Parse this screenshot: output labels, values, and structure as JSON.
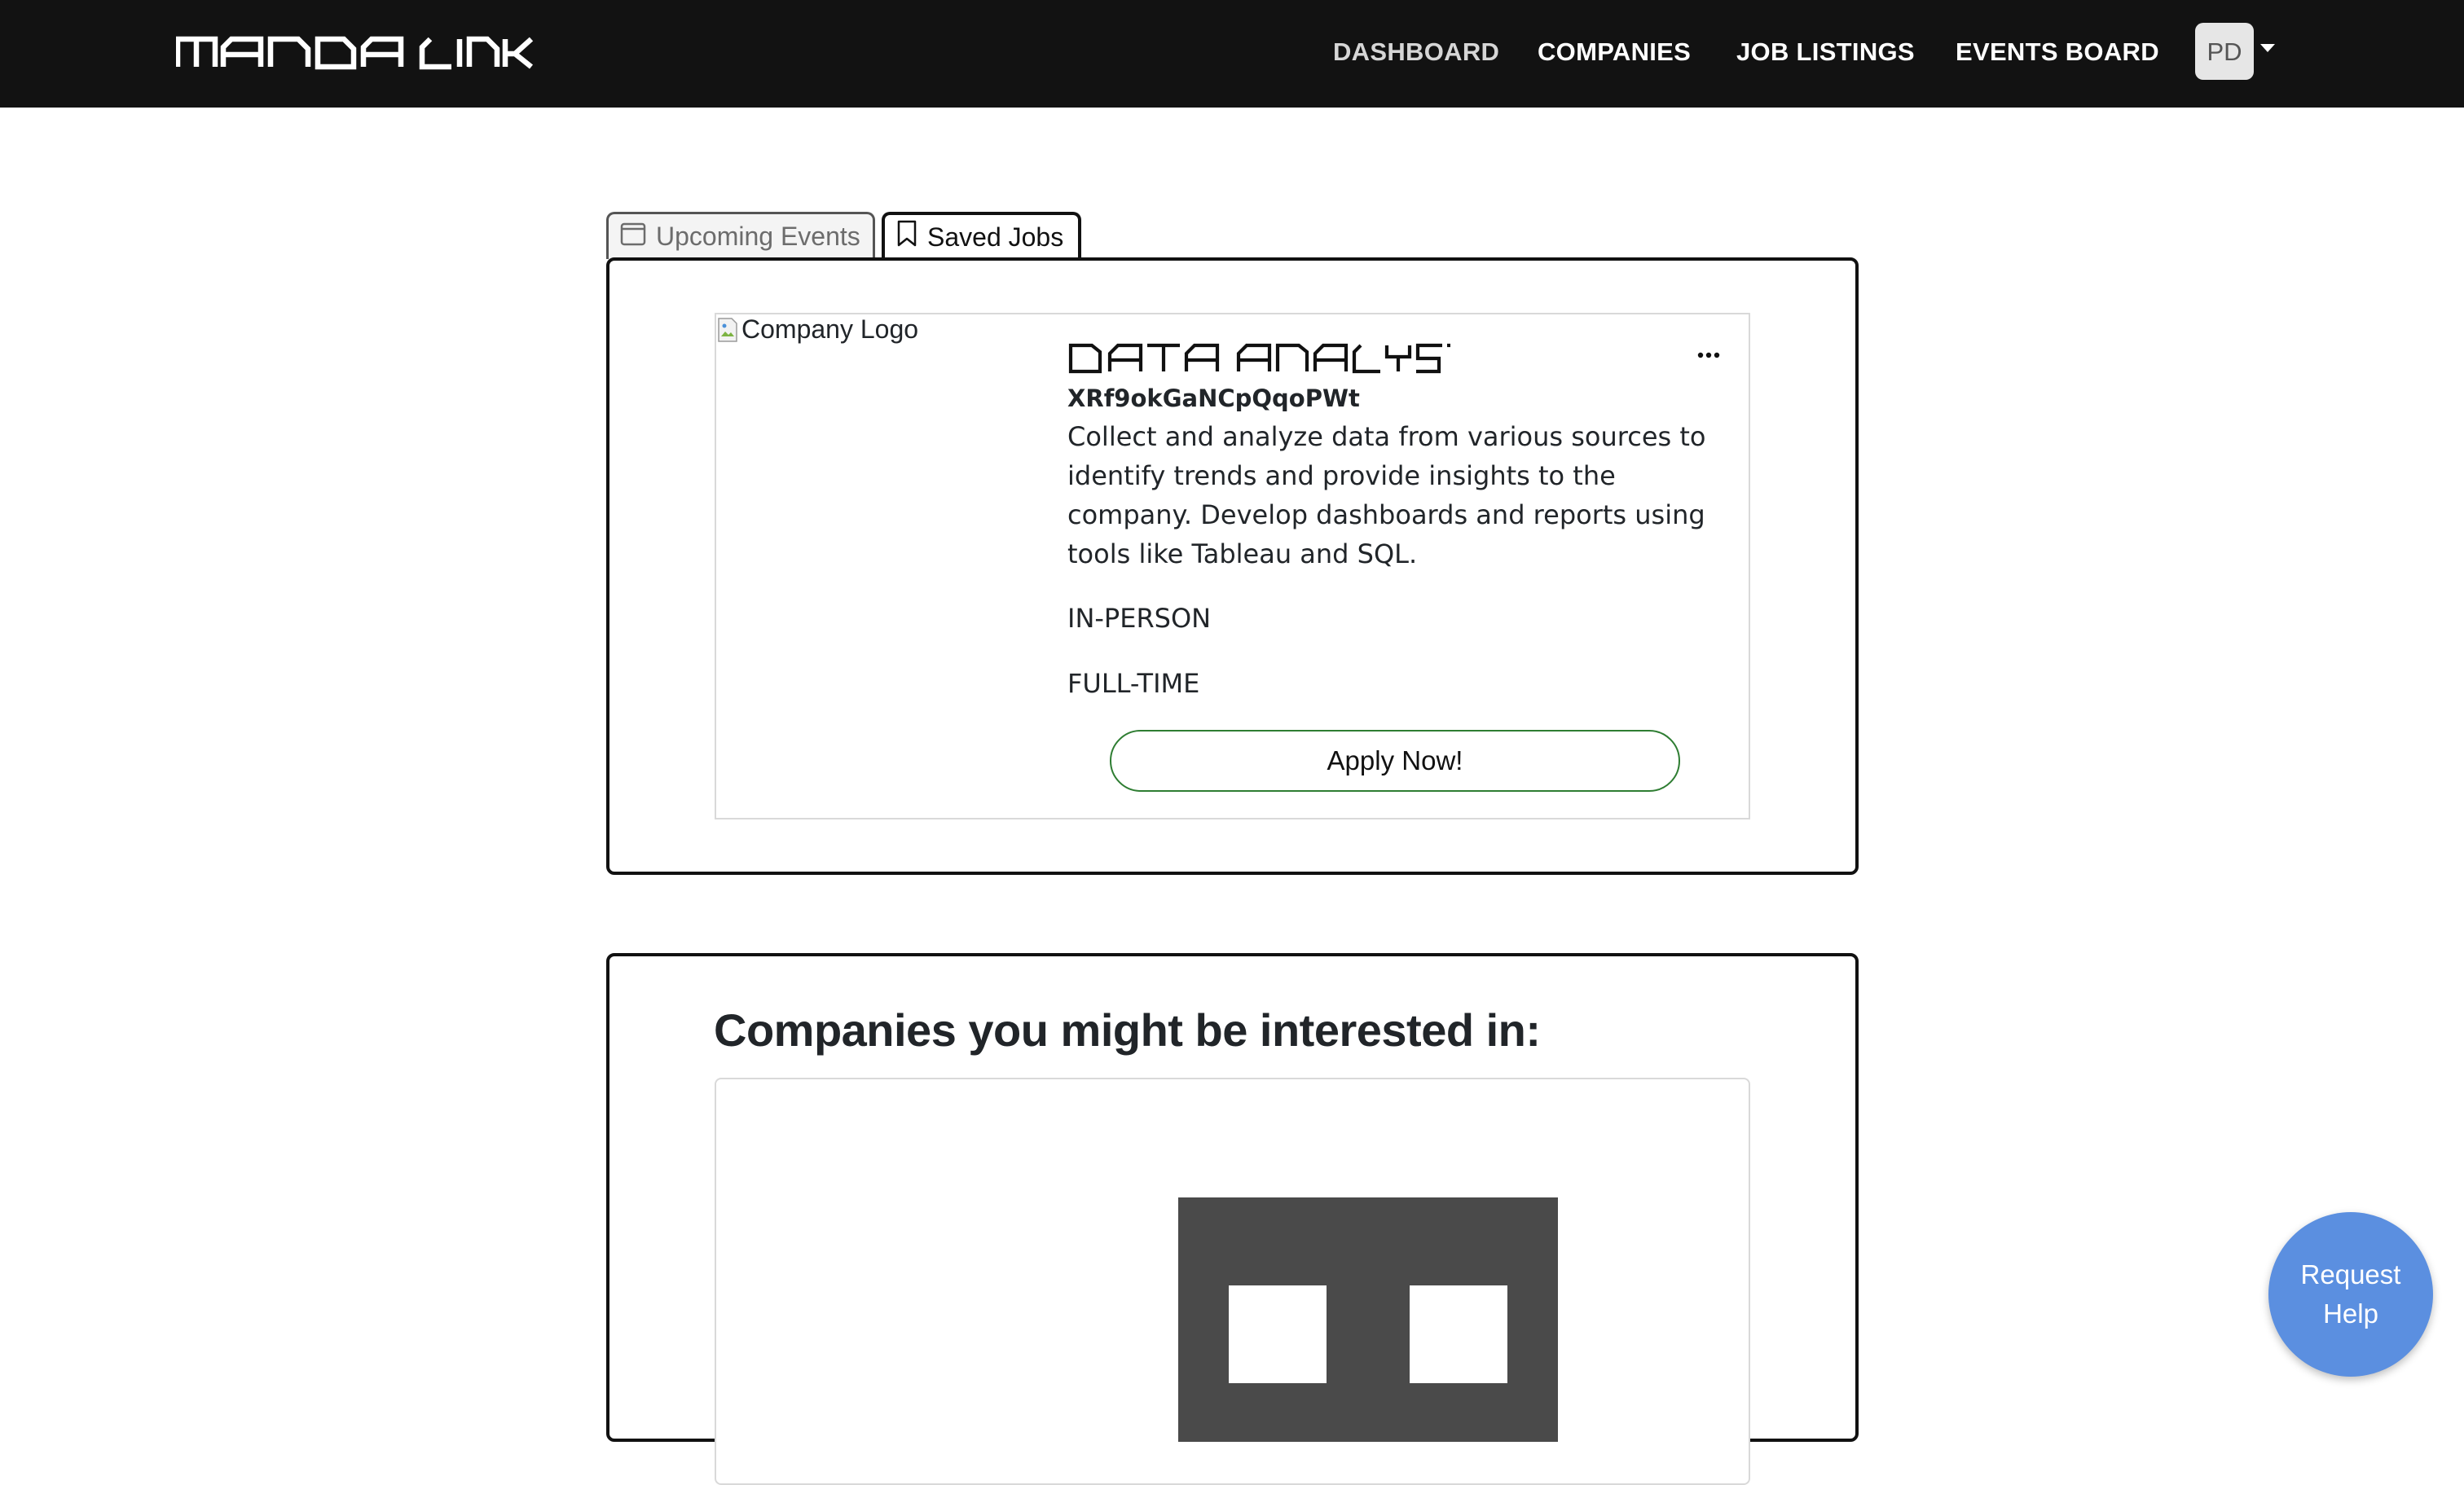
{
  "navbar": {
    "brand": "MANOA LINK",
    "links": {
      "dashboard": "DASHBOARD",
      "companies": "COMPANIES",
      "job_listings": "JOB LISTINGS",
      "events_board": "EVENTS BOARD"
    },
    "avatar_initials": "PD",
    "active_link_color": "#d6d6d6",
    "background": "#121212"
  },
  "tabs": {
    "upcoming_events": {
      "label": "Upcoming Events",
      "icon": "calendar-icon"
    },
    "saved_jobs": {
      "label": "Saved Jobs",
      "icon": "bookmark-icon",
      "selected": true
    }
  },
  "saved_job": {
    "logo_alt": "Company Logo",
    "title": "DATA ANALYST",
    "company": "XRf9okGaNCpQqoPWt",
    "description": "Collect and analyze data from various sources to identify trends and provide insights to the company. Develop dashboards and reports using tools like Tableau and SQL.",
    "location_type": "IN-PERSON",
    "employment_type": "FULL-TIME",
    "apply_label": "Apply Now!",
    "menu_icon": "more-horizontal-icon"
  },
  "companies_section": {
    "heading": "Companies you might be interested in:",
    "placeholder_icon": "building-icon"
  },
  "help_button": {
    "line1": "Request",
    "line2": "Help",
    "color": "#5b8fe0"
  }
}
